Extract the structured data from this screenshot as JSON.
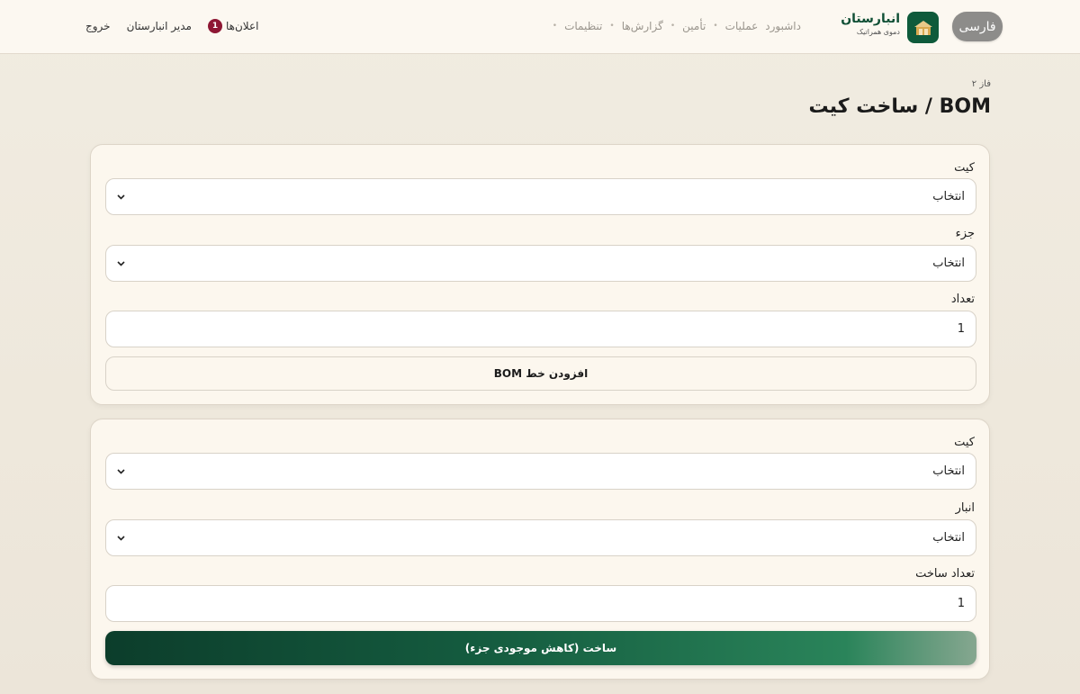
{
  "header": {
    "language_label": "فارسی",
    "brand_title": "انبارستان",
    "brand_subtitle": "دموی همراتیک",
    "nav": [
      "داشبورد",
      "عملیات",
      "تأمین",
      "گزارش‌ها",
      "تنظیمات"
    ],
    "notifications_label": "اعلان‌ها",
    "notifications_count": "1",
    "user_label": "مدیر انبارستان",
    "logout_label": "خروج"
  },
  "page": {
    "phase": "فاز ۲",
    "title": "BOM / ساخت کیت"
  },
  "bom_form": {
    "kit_label": "کیت",
    "kit_value": "انتخاب",
    "part_label": "جزء",
    "part_value": "انتخاب",
    "qty_label": "تعداد",
    "qty_value": "1",
    "add_button": "افزودن خط BOM"
  },
  "build_form": {
    "kit_label": "کیت",
    "kit_value": "انتخاب",
    "warehouse_label": "انبار",
    "warehouse_value": "انتخاب",
    "qty_label": "تعداد ساخت",
    "qty_value": "1",
    "build_button": "ساخت (کاهش موجودی جزء)"
  },
  "colors": {
    "brand_green": "#0e5a3b",
    "badge_red": "#8e1734",
    "card_bg": "#fcf7ee"
  }
}
